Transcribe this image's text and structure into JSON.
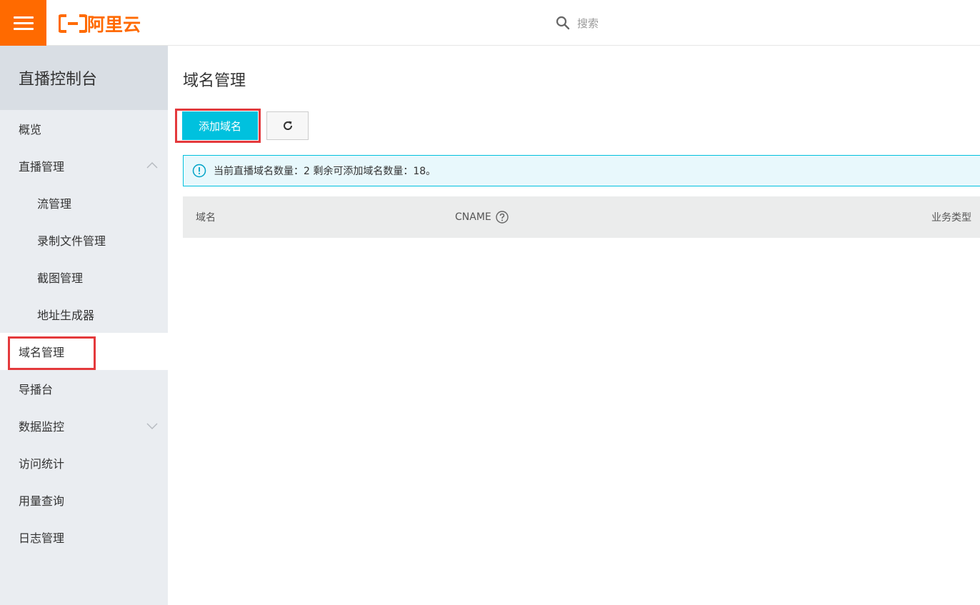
{
  "brand": {
    "name": "阿里云",
    "color": "#ff6a00",
    "menu_icon": "hamburger-icon"
  },
  "search": {
    "placeholder": "搜索",
    "icon": "search-icon"
  },
  "sidebar": {
    "title": "直播控制台",
    "items": [
      {
        "label": "概览",
        "level": 1
      },
      {
        "label": "直播管理",
        "level": 1,
        "expanded": true,
        "icon": "chevron-up-icon"
      },
      {
        "label": "流管理",
        "level": 2
      },
      {
        "label": "录制文件管理",
        "level": 2
      },
      {
        "label": "截图管理",
        "level": 2
      },
      {
        "label": "地址生成器",
        "level": 2
      },
      {
        "label": "域名管理",
        "level": 1,
        "active": true
      },
      {
        "label": "导播台",
        "level": 1
      },
      {
        "label": "数据监控",
        "level": 1,
        "expanded": false,
        "icon": "chevron-down-icon"
      },
      {
        "label": "访问统计",
        "level": 1
      },
      {
        "label": "用量查询",
        "level": 1
      },
      {
        "label": "日志管理",
        "level": 1
      }
    ]
  },
  "main": {
    "title": "域名管理",
    "add_button": "添加域名",
    "refresh_icon": "refresh-icon",
    "alert": {
      "icon": "info-icon",
      "text": "当前直播域名数量：2 剩余可添加域名数量：18。"
    },
    "table": {
      "columns": [
        "域名",
        "CNAME",
        "业务类型"
      ],
      "cname_help_icon": "help-icon"
    }
  },
  "colors": {
    "accent": "#00c1de",
    "highlight": "#e4393c",
    "sidebar_bg": "#eaedf1"
  }
}
